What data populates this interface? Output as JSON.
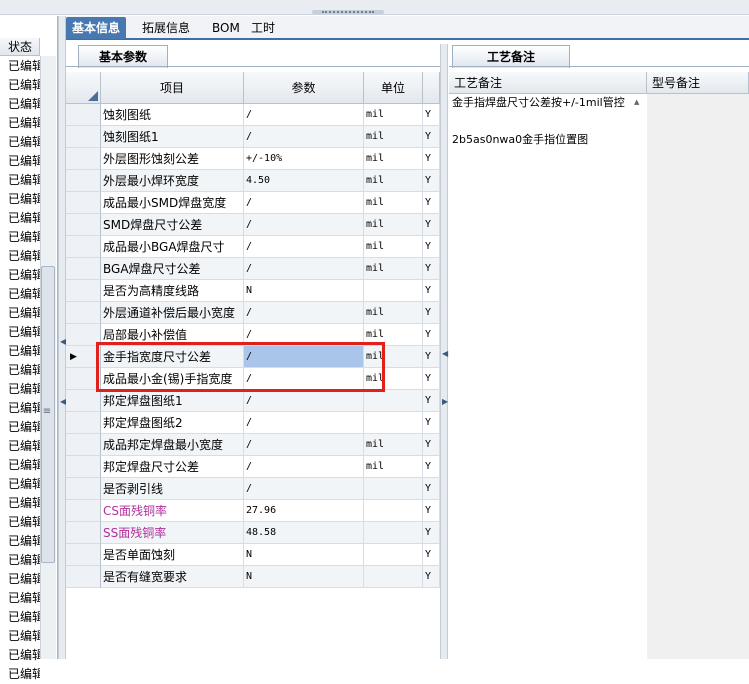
{
  "tabs": [
    {
      "label": "基本信息",
      "active": true
    },
    {
      "label": "拓展信息",
      "active": false
    },
    {
      "label": "BOM",
      "active": false
    },
    {
      "label": "工时",
      "active": false
    }
  ],
  "left_panel": {
    "header": "状态",
    "rows": [
      "已编辑",
      "已编辑",
      "已编辑",
      "已编辑",
      "已编辑",
      "已编辑",
      "已编辑",
      "已编辑",
      "已编辑",
      "已编辑",
      "已编辑",
      "已编辑",
      "已编辑",
      "已编辑",
      "已编辑",
      "已编辑",
      "已编辑",
      "已编辑",
      "已编辑",
      "已编辑",
      "已编辑",
      "已编辑",
      "已编辑",
      "已编辑",
      "已编辑",
      "已编辑",
      "已编辑",
      "已编辑",
      "已编辑",
      "已编辑",
      "已编辑",
      "已编辑",
      "已编辑"
    ]
  },
  "basic_params": {
    "title": "基本参数",
    "columns": {
      "item": "项目",
      "param": "参数",
      "unit": "单位"
    },
    "rows": [
      {
        "item": "蚀刻图纸",
        "param": "/",
        "unit": "mil",
        "flag": "Y"
      },
      {
        "item": "蚀刻图纸1",
        "param": "/",
        "unit": "mil",
        "flag": "Y"
      },
      {
        "item": "外层图形蚀刻公差",
        "param": "+/-10%",
        "unit": "mil",
        "flag": "Y"
      },
      {
        "item": "外层最小焊环宽度",
        "param": "4.50",
        "unit": "mil",
        "flag": "Y"
      },
      {
        "item": "成品最小SMD焊盘宽度",
        "param": "/",
        "unit": "mil",
        "flag": "Y"
      },
      {
        "item": "SMD焊盘尺寸公差",
        "param": "/",
        "unit": "mil",
        "flag": "Y"
      },
      {
        "item": "成品最小BGA焊盘尺寸",
        "param": "/",
        "unit": "mil",
        "flag": "Y"
      },
      {
        "item": "BGA焊盘尺寸公差",
        "param": "/",
        "unit": "mil",
        "flag": "Y"
      },
      {
        "item": "是否为高精度线路",
        "param": "N",
        "unit": "",
        "flag": "Y"
      },
      {
        "item": "外层通道补偿后最小宽度",
        "param": "/",
        "unit": "mil",
        "flag": "Y"
      },
      {
        "item": "局部最小补偿值",
        "param": "/",
        "unit": "mil",
        "flag": "Y"
      },
      {
        "item": "金手指宽度尺寸公差",
        "param": "/",
        "unit": "mil",
        "flag": "Y"
      },
      {
        "item": "成品最小金(锡)手指宽度",
        "param": "/",
        "unit": "mil",
        "flag": "Y"
      },
      {
        "item": "邦定焊盘图纸1",
        "param": "/",
        "unit": "",
        "flag": "Y"
      },
      {
        "item": "邦定焊盘图纸2",
        "param": "/",
        "unit": "",
        "flag": "Y"
      },
      {
        "item": "成品邦定焊盘最小宽度",
        "param": "/",
        "unit": "mil",
        "flag": "Y"
      },
      {
        "item": "邦定焊盘尺寸公差",
        "param": "/",
        "unit": "mil",
        "flag": "Y"
      },
      {
        "item": "是否剥引线",
        "param": "/",
        "unit": "",
        "flag": "Y"
      },
      {
        "item": "CS面残铜率",
        "param": "27.96",
        "unit": "",
        "flag": "Y"
      },
      {
        "item": "SS面残铜率",
        "param": "48.58",
        "unit": "",
        "flag": "Y"
      },
      {
        "item": "是否单面蚀刻",
        "param": "N",
        "unit": "",
        "flag": "Y"
      },
      {
        "item": "是否有缝宽要求",
        "param": "N",
        "unit": "",
        "flag": "Y"
      }
    ]
  },
  "remarks": {
    "title": "工艺备注",
    "col_craft": "工艺备注",
    "col_model": "型号备注",
    "note1": "金手指焊盘尺寸公差按+/-1mil管控",
    "note2": "2b5as0nwa0金手指位置图"
  },
  "colors": {
    "accent": "#4878b0",
    "highlight_box": "#e0201b",
    "pink_text": "#b0309a",
    "selected_cell": "#a9c6ea"
  }
}
